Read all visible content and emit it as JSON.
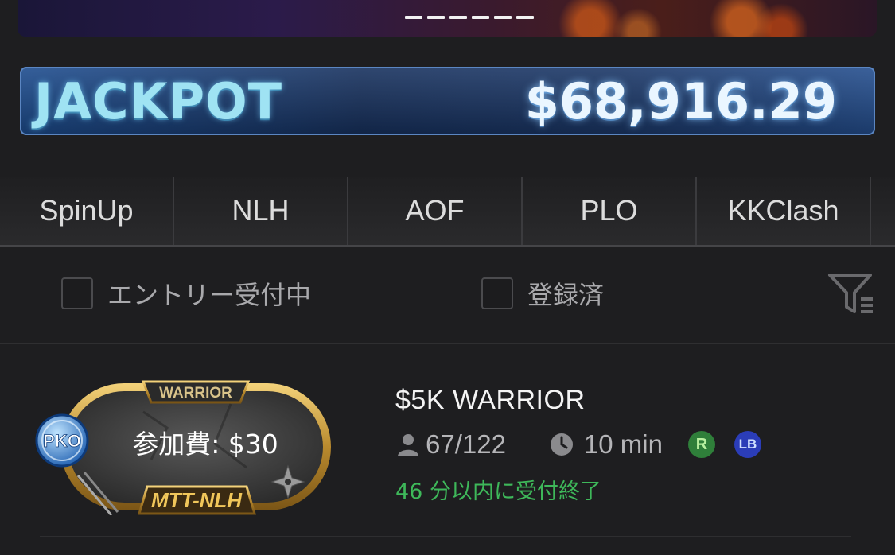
{
  "banner": {
    "slide_count": 6
  },
  "jackpot": {
    "label": "JACKPOT",
    "amount": "$68,916.29"
  },
  "tabs": [
    {
      "label": "SpinUp"
    },
    {
      "label": "NLH"
    },
    {
      "label": "AOF"
    },
    {
      "label": "PLO"
    },
    {
      "label": "KKClash"
    }
  ],
  "filters": {
    "entry_open": {
      "label": "エントリー受付中",
      "checked": false
    },
    "registered": {
      "label": "登録済",
      "checked": false
    },
    "filter_icon": "funnel-filter-icon"
  },
  "tournament": {
    "badge": {
      "top_label": "WARRIOR",
      "fee": "参加費: $30",
      "type": "MTT-NLH",
      "bounty_label": "PKO"
    },
    "title": "$5K WARRIOR",
    "players": "67/122",
    "duration": "10 min",
    "tags": [
      "R",
      "LB"
    ],
    "countdown": "46 分以内に受付終了"
  },
  "colors": {
    "background": "#1e1e20",
    "countdown_green": "#3eb85a",
    "jackpot_blue": "#1d4c8e",
    "badge_gold": "#c9a24a"
  }
}
